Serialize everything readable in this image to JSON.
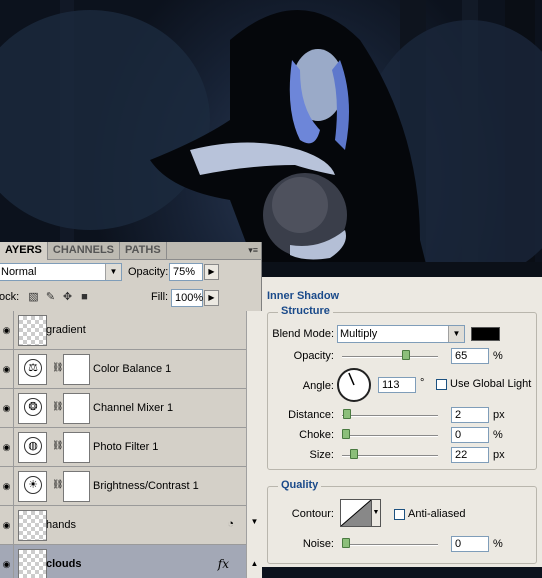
{
  "layers_panel": {
    "tabs": [
      "AYERS",
      "CHANNELS",
      "PATHS"
    ],
    "menu_glyph": "▾≡",
    "blend_mode": "Normal",
    "opacity_label": "Opacity:",
    "opacity_value": "75%",
    "lock_label": "ock:",
    "fill_label": "Fill:",
    "fill_value": "100%",
    "layers": [
      {
        "name": "gradient",
        "thumb": "checker",
        "has_mask": false,
        "fx": ""
      },
      {
        "name": "Color Balance 1",
        "thumb": "color-balance-icon",
        "has_mask": true,
        "fx": ""
      },
      {
        "name": "Channel Mixer 1",
        "thumb": "channel-mixer-icon",
        "has_mask": true,
        "fx": ""
      },
      {
        "name": "Photo Filter 1",
        "thumb": "photo-filter-icon",
        "has_mask": true,
        "fx": ""
      },
      {
        "name": "Brightness/Contrast 1",
        "thumb": "brightness-contrast-icon",
        "has_mask": true,
        "fx": ""
      },
      {
        "name": "hands",
        "thumb": "checker",
        "has_mask": false,
        "fx": ""
      },
      {
        "name": "clouds",
        "thumb": "checker",
        "has_mask": false,
        "fx": "fx",
        "selected": true
      }
    ]
  },
  "inner_shadow": {
    "title": "Inner Shadow",
    "structure": {
      "title": "Structure",
      "blend_mode_label": "Blend Mode:",
      "blend_mode_value": "Multiply",
      "shadow_color": "#000000",
      "opacity_label": "Opacity:",
      "opacity_value": "65",
      "opacity_unit": "%",
      "angle_label": "Angle:",
      "angle_value": "113",
      "angle_unit": "°",
      "use_global_light_label": "Use Global Light",
      "use_global_light_checked": false,
      "distance_label": "Distance:",
      "distance_value": "2",
      "distance_unit": "px",
      "choke_label": "Choke:",
      "choke_value": "0",
      "choke_unit": "%",
      "size_label": "Size:",
      "size_value": "22",
      "size_unit": "px"
    },
    "quality": {
      "title": "Quality",
      "contour_label": "Contour:",
      "anti_aliased_label": "Anti-aliased",
      "anti_aliased_checked": false,
      "noise_label": "Noise:",
      "noise_value": "0",
      "noise_unit": "%"
    }
  }
}
